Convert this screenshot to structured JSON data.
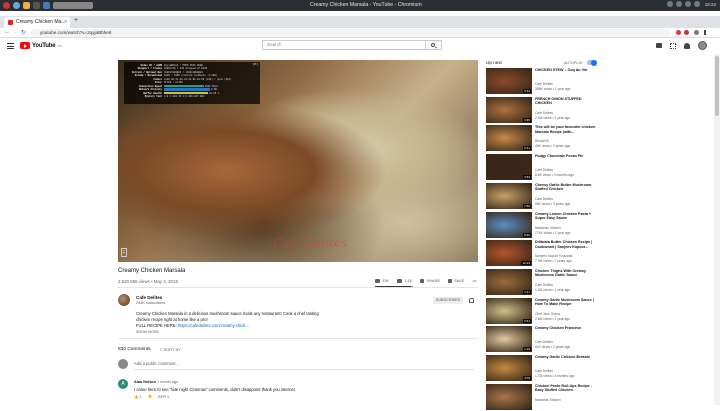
{
  "os": {
    "window_title": "Creamy Chicken Marsala - YouTube - Chromium",
    "clock": "18:22"
  },
  "browser": {
    "tab_title": "Creamy Chicken Ma...",
    "url": "youtube.com/watch?v=2qyjaBbhe6"
  },
  "header": {
    "logo_text": "YouTube",
    "logo_country": "CA",
    "search_placeholder": "Search"
  },
  "player": {
    "watermark": "Cafe Delites",
    "stats": [
      {
        "k": "Video ID / sCPN",
        "v": "2qyjaBbhe6 / P5RK 3KFF GDHE"
      },
      {
        "k": "Viewport / Frames",
        "v": "1080x720 / 449 dropped of 9243"
      },
      {
        "k": "Current / Optimal Res",
        "v": "1920x1080@24 / 1920x1080@24"
      },
      {
        "k": "Volume / Normalized",
        "v": "100% / 100% (content loudness -3.1dB)"
      },
      {
        "k": "Codecs",
        "v": "vp09.00.51.08.01.01.01.01.00 (248) / opus (251)"
      },
      {
        "k": "Color",
        "v": "bt709 / bt709"
      },
      {
        "k": "Connection Speed",
        "v": "6982 Kbps"
      },
      {
        "k": "Network Activity",
        "v": "0 KB"
      },
      {
        "k": "Buffer Health",
        "v": "44.25 s"
      },
      {
        "k": "Mystery Text",
        "v": "s:8 t:194.39 b:0.000-197.081"
      }
    ]
  },
  "video": {
    "title": "Creamy Chicken Marsala",
    "views": "2,920,555 views",
    "date": "May 3, 2018",
    "likes": "33K",
    "dislikes": "1.1K",
    "share": "SHARE",
    "save": "SAVE",
    "like_ratio": 0.96
  },
  "channel": {
    "name": "Cafe Delites",
    "subscribers": "244K subscribers",
    "subscribe_label": "SUBSCRIBED",
    "description_1": "Creamy Chicken Marsala in a delicious mushroom sauce rivals any restaurant! Cook a chef tasting",
    "description_2": "chicken recipe right at home like a pro!",
    "description_3": "FULL RECIPE HERE:",
    "description_link": "https://cafedelites.com/creamy-chick...",
    "show_more": "SHOW MORE"
  },
  "comments": {
    "count": "830 Comments",
    "sort_by": "SORT BY",
    "add_placeholder": "Add a public comment...",
    "items": [
      {
        "avatar_letter": "A",
        "author": "Alan Nelson",
        "time": "1 month ago",
        "text": "I came here to see \"late night Cinemax\" comments, didn't disappoint thank you internet",
        "likes": "1",
        "reply": "REPLY"
      }
    ]
  },
  "sidebar": {
    "up_next": "Up next",
    "autoplay": "AUTOPLAY",
    "recommendations": [
      {
        "title": "CHICKEN STEW – Coq Au Vin",
        "channel": "Cafe Delites",
        "meta": "389K views • 1 year ago",
        "duration": "5:14",
        "thumb": "#8a4a2a"
      },
      {
        "title": "FRENCH ONION STUFFED CHICKEN",
        "channel": "Cafe Delites",
        "meta": "2.3M views • 1 year ago",
        "duration": "3:36",
        "thumb": "#b07040"
      },
      {
        "title": "This will be your favourite chicken Marsala Recipe (with...",
        "channel": "Recipe30",
        "meta": "40K views • 2 years ago",
        "duration": "5:41",
        "thumb": "#c58a4a"
      },
      {
        "title": "Fudgy Chocolate Pecan Pie",
        "channel": "Cafe Delites",
        "meta": "8.8K views • 4 months ago",
        "duration": "3:53",
        "thumb": "#3b2418"
      },
      {
        "title": "Cheesy Garlic Butter Mushroom Stuffed Chicken",
        "channel": "Cafe Delites",
        "meta": "96K views • 3 years ago",
        "duration": "1:56",
        "thumb": "#c9a26a"
      },
      {
        "title": "Creamy Lemon Chicken Pasta + Super Easy Sauce",
        "channel": "Natashas Kitchen",
        "meta": "774K views • 1 year ago",
        "duration": "8:20",
        "thumb": "#5a8fc4"
      },
      {
        "title": "Dilliwala Butter Chicken Recipe | Cooksmart | Sanjeev Kapoor...",
        "channel": "Sanjeev Kapoor Khazana",
        "meta": "7.5M views • 2 years ago",
        "duration": "12:23",
        "thumb": "#b5542a"
      },
      {
        "title": "Chicken Thighs With Creamy Mushroom Garlic Sauce",
        "channel": "Cafe Delites",
        "meta": "1.3M views • 1 year ago",
        "duration": "1:47",
        "thumb": "#9a6a3a"
      },
      {
        "title": "Creamy Garlic Mushroom Sauce | How To Make Recipe",
        "channel": "Chef Jack Ovens",
        "meta": "2.6M views • 1 year ago",
        "duration": "6:51",
        "thumb": "#d0c08a"
      },
      {
        "title": "Creamy Chicken Francese",
        "channel": "Cafe Delites",
        "meta": "51K views • 2 years ago",
        "duration": "1:19",
        "thumb": "#e0c9a0"
      },
      {
        "title": "Creamy Garlic Chicken Breasts",
        "channel": "Cafe Delites",
        "meta": "1.7M views • 4 months ago",
        "duration": "3:09",
        "thumb": "#c68a40"
      },
      {
        "title": "Chicken Pesto Roll-Ups Recipe - Easy Stuffed Chicken",
        "channel": "Natashas Kitchen",
        "meta": "",
        "duration": "",
        "thumb": "#a8744a"
      }
    ]
  }
}
